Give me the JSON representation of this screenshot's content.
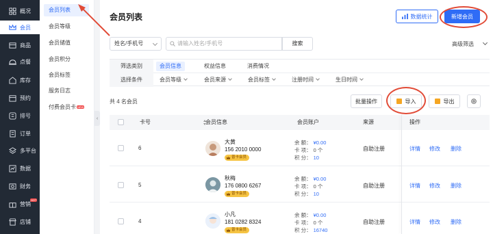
{
  "nav": {
    "items": [
      {
        "label": "概况",
        "icon": "overview-icon"
      },
      {
        "label": "会员",
        "icon": "crown-icon"
      },
      {
        "label": "商品",
        "icon": "box-icon"
      },
      {
        "label": "点餐",
        "icon": "cloche-icon"
      },
      {
        "label": "库存",
        "icon": "warehouse-icon"
      },
      {
        "label": "预约",
        "icon": "calendar-icon"
      },
      {
        "label": "排号",
        "icon": "queue-icon"
      },
      {
        "label": "订单",
        "icon": "order-icon"
      },
      {
        "label": "多平台",
        "icon": "layers-icon"
      },
      {
        "label": "数据",
        "icon": "chart-icon"
      },
      {
        "label": "财务",
        "icon": "finance-icon"
      },
      {
        "label": "营销",
        "icon": "gift-icon",
        "tag": "HOT"
      },
      {
        "label": "店铺",
        "icon": "store-icon"
      }
    ]
  },
  "submenu": {
    "items": [
      {
        "label": "会员列表"
      },
      {
        "label": "会员等级"
      },
      {
        "label": "会员储值"
      },
      {
        "label": "会员积分"
      },
      {
        "label": "会员标签"
      },
      {
        "label": "服务日志"
      },
      {
        "label": "付费会员卡",
        "tag": "NEW"
      }
    ]
  },
  "header": {
    "title": "会员列表",
    "stats_label": "数据统计",
    "add_label": "新增会员"
  },
  "search": {
    "type_value": "姓名/手机号",
    "placeholder": "请输入姓名/手机号",
    "button": "搜索",
    "advanced": "高级筛选"
  },
  "filter": {
    "category_label": "筛选类别",
    "categories": [
      "会员信息",
      "权益信息",
      "消费情况"
    ],
    "condition_label": "选择条件",
    "conditions": [
      "会员等级",
      "会员来源",
      "会员标签",
      "注册时间",
      "生日时间"
    ]
  },
  "toolbar": {
    "total": "共 4 名会员",
    "batch": "批量操作",
    "import": "导入",
    "export": "导出"
  },
  "table": {
    "columns": [
      "卡号",
      "会员信息",
      "会员账户",
      "来源",
      "操作"
    ],
    "account_labels": [
      "余 额：",
      "卡 项：",
      "积 分："
    ],
    "actions": [
      "详情",
      "修改",
      "删除"
    ],
    "rows": [
      {
        "card": "6",
        "name": "大黄",
        "phone": "156 2010 0000",
        "badge": "普卡会员",
        "balance": "¥0.00",
        "cards": "0 个",
        "points": "10",
        "source": "自助注册"
      },
      {
        "card": "5",
        "name": "秋梅",
        "phone": "176 0800 6267",
        "badge": "普卡会员",
        "balance": "¥0.00",
        "cards": "0 个",
        "points": "10",
        "source": "自助注册"
      },
      {
        "card": "4",
        "name": "小凡",
        "phone": "181 0282 8324",
        "badge": "普卡会员",
        "balance": "¥0.00",
        "cards": "0 个",
        "points": "16740",
        "source": "自助注册"
      }
    ]
  },
  "colors": {
    "primary": "#2f6cf6",
    "nav_bg": "#222a35",
    "annotation": "#e14b37",
    "badge": "#f6c443"
  }
}
